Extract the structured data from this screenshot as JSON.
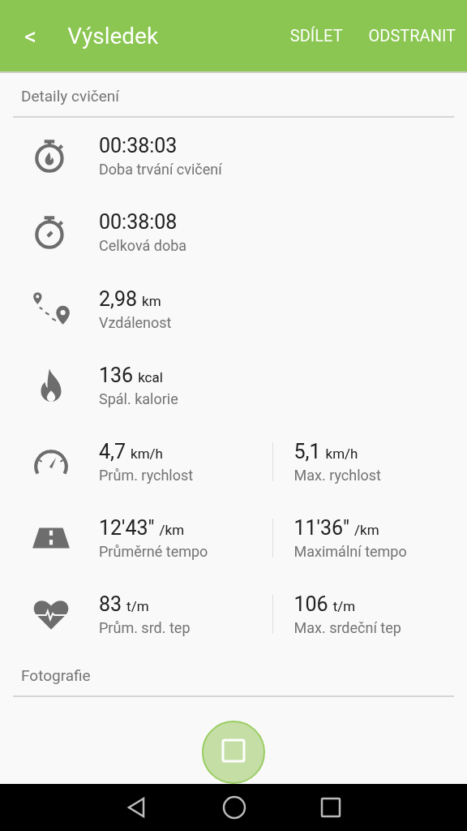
{
  "app_bar": {
    "back": "<",
    "title": "Výsledek",
    "actions": [
      "SDÍLET",
      "ODSTRANIT"
    ]
  },
  "sections": [
    {
      "title": "Detaily cvičení",
      "stats": [
        {
          "kind": "stopwatch-flame",
          "items": [
            {
              "value": "00:38:03",
              "label": "Doba trvání cvičení"
            }
          ]
        },
        {
          "kind": "stopwatch",
          "items": [
            {
              "value": "00:38:08",
              "label": "Celková doba"
            }
          ]
        },
        {
          "kind": "route",
          "items": [
            {
              "value": "2,98",
              "unit": "km",
              "label": "Vzdálenost"
            }
          ]
        },
        {
          "kind": "flame",
          "items": [
            {
              "value": "136",
              "unit": "kcal",
              "label": "Spál. kalorie"
            }
          ]
        },
        {
          "kind": "speedometer",
          "items": [
            {
              "value": "4,7",
              "unit": "km/h",
              "label": "Prům. rychlost"
            },
            {
              "value": "5,1",
              "unit": "km/h",
              "label": "Max. rychlost"
            }
          ]
        },
        {
          "kind": "road",
          "items": [
            {
              "value": "12'43\"",
              "unit": "/km",
              "label": "Průměrné tempo"
            },
            {
              "value": "11'36\"",
              "unit": "/km",
              "label": "Maximální tempo"
            }
          ]
        },
        {
          "kind": "heart",
          "items": [
            {
              "value": "83",
              "unit": "t/m",
              "label": "Prům. srd. tep"
            },
            {
              "value": "106",
              "unit": "t/m",
              "label": "Max. srdeční tep"
            }
          ]
        }
      ]
    },
    {
      "title": "Fotografie"
    }
  ]
}
